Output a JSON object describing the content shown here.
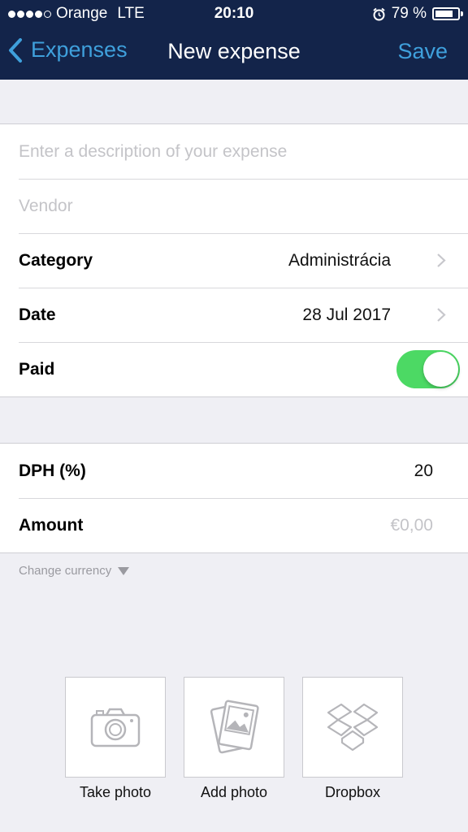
{
  "status_bar": {
    "carrier": "Orange",
    "network": "LTE",
    "time": "20:10",
    "battery_percent": "79 %",
    "battery_level": 0.79,
    "signal_bars_filled": 4,
    "signal_bars_total": 5
  },
  "nav": {
    "back_label": "Expenses",
    "title": "New expense",
    "save_label": "Save"
  },
  "form": {
    "description_placeholder": "Enter a description of your expense",
    "vendor_placeholder": "Vendor",
    "category_label": "Category",
    "category_value": "Administrácia",
    "date_label": "Date",
    "date_value": "28 Jul 2017",
    "paid_label": "Paid",
    "paid_on": true
  },
  "amounts": {
    "dph_label": "DPH (%)",
    "dph_value": "20",
    "amount_label": "Amount",
    "amount_placeholder": "€0,00"
  },
  "change_currency": "Change currency",
  "attachments": [
    {
      "label": "Take photo",
      "icon": "camera-icon"
    },
    {
      "label": "Add photo",
      "icon": "photos-icon"
    },
    {
      "label": "Dropbox",
      "icon": "dropbox-icon"
    }
  ],
  "colors": {
    "nav_background": "#13244a",
    "accent": "#3fa0dc",
    "toggle_on": "#4cd964"
  }
}
